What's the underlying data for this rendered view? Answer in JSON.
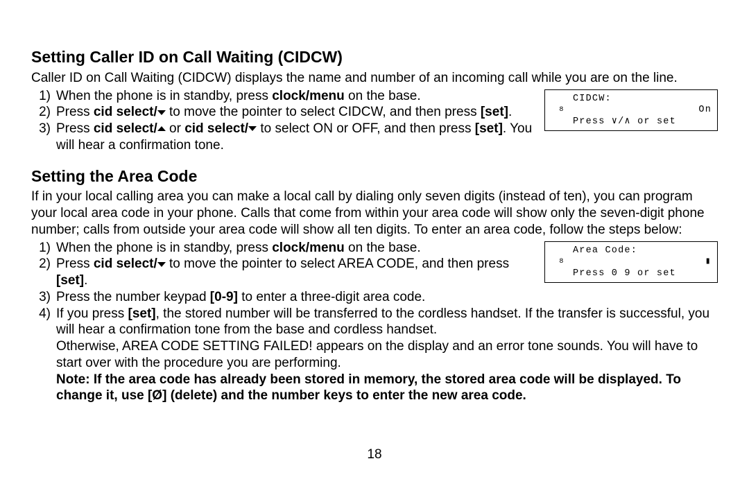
{
  "section1": {
    "title": "Setting Caller ID on Call Waiting (CIDCW)",
    "intro": "Caller ID on Call Waiting (CIDCW) displays the name and number of an incoming call while you are on the line.",
    "steps": [
      {
        "n": "1)",
        "pre": "When the phone is in standby, press ",
        "b1": "clock/menu",
        "post": " on the base."
      },
      {
        "n": "2)",
        "pre": "Press ",
        "b1": "cid select/",
        "mid": " to move the pointer to select CIDCW, and then press ",
        "b2": "[set]",
        "post": "."
      },
      {
        "n": "3)",
        "pre": "Press ",
        "b1": "cid select/",
        "mid": " or ",
        "b2": "cid select/",
        "mid2": " to select ON or OFF, and then press ",
        "b3": "[set]",
        "post": ". You will hear a confirmation tone."
      }
    ],
    "lcd": {
      "icon": "8",
      "line1": "CIDCW:",
      "line2": "On",
      "line3": "Press ∨/∧ or set"
    }
  },
  "section2": {
    "title": "Setting the Area Code",
    "intro": "If in your local calling area you can make a local call by dialing only seven digits (instead of ten), you can program your local area code in your phone. Calls that come from within your area code will show only the seven-digit phone number; calls from outside your area code will show all ten digits. To enter an area code, follow the steps below:",
    "steps": [
      {
        "n": "1)",
        "pre": "When the phone is in standby, press ",
        "b1": "clock/menu",
        "post": " on the base."
      },
      {
        "n": "2)",
        "pre": "Press ",
        "b1": "cid select/",
        "mid": " to move the pointer to select AREA CODE, and then press ",
        "b2": "[set]",
        "post": "."
      },
      {
        "n": "3)",
        "pre": "Press the number keypad ",
        "b1": "[0-9]",
        "post": " to enter a three-digit area code."
      },
      {
        "n": "4)",
        "pre": "If you press ",
        "b1": "[set]",
        "post": ", the stored number will be transferred to the cordless handset. If the transfer is successful, you will hear a confirmation tone from the base and cordless handset.",
        "extra": "Otherwise, AREA CODE SETTING FAILED! appears on the display and an error tone sounds. You will have to start over with the procedure you are performing."
      }
    ],
    "note": "Note: If the area code has already been stored in memory, the stored area code will be displayed. To change it, use [Ø] (delete) and the number keys to enter the new area code.",
    "lcd": {
      "icon": "8",
      "line1": "Area Code:",
      "line2": "▮",
      "line3": "Press 0 9 or set"
    }
  },
  "page": "18"
}
